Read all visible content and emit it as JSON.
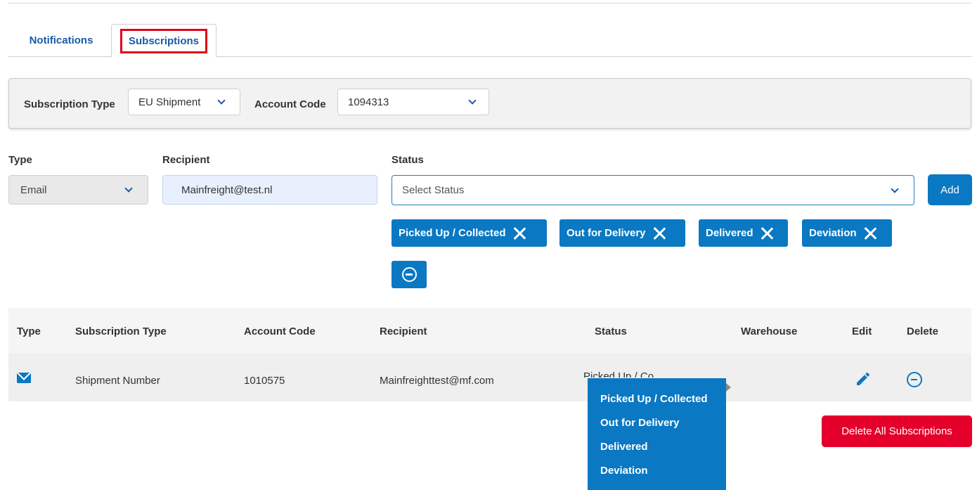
{
  "tabs": {
    "notifications": "Notifications",
    "subscriptions": "Subscriptions"
  },
  "filter": {
    "subscription_type_label": "Subscription Type",
    "subscription_type_value": "EU Shipment",
    "account_code_label": "Account Code",
    "account_code_value": "1094313"
  },
  "form": {
    "type_label": "Type",
    "type_value": "Email",
    "recipient_label": "Recipient",
    "recipient_value": "Mainfreight@test.nl",
    "status_label": "Status",
    "status_placeholder": "Select Status",
    "add_label": "Add",
    "selected_statuses": [
      "Picked Up / Collected",
      "Out for Delivery",
      "Delivered",
      "Deviation"
    ]
  },
  "table": {
    "headers": {
      "type": "Type",
      "subscription_type": "Subscription Type",
      "account_code": "Account Code",
      "recipient": "Recipient",
      "status": "Status",
      "warehouse": "Warehouse",
      "edit": "Edit",
      "delete": "Delete"
    },
    "rows": [
      {
        "type_icon": "mail-icon",
        "subscription_type": "Shipment Number",
        "account_code": "1010575",
        "recipient": "Mainfreighttest@mf.com",
        "status": "Picked Up / Co",
        "warehouse": ""
      }
    ]
  },
  "status_popup": {
    "items": [
      "Picked Up / Collected",
      "Out for Delivery",
      "Delivered",
      "Deviation"
    ]
  },
  "delete_all_label": "Delete All Subscriptions",
  "colors": {
    "primary": "#0a78c2",
    "tab_text": "#1a5aa8",
    "danger": "#e4002b",
    "highlight_border": "#e0001b"
  }
}
